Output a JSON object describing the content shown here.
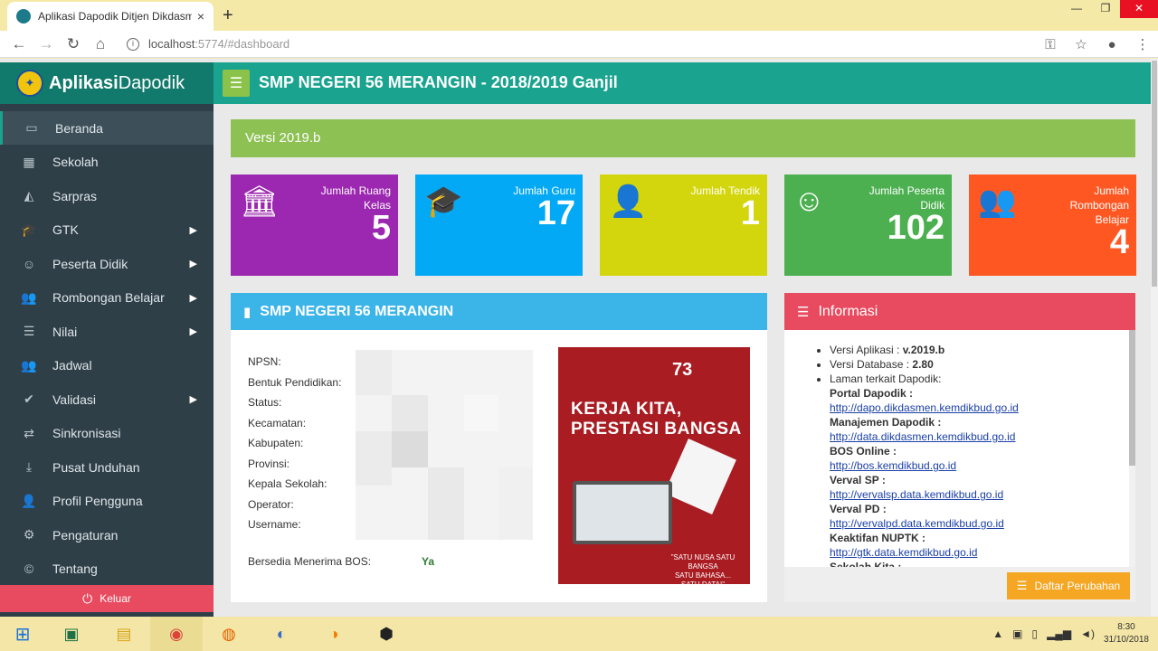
{
  "browser": {
    "tab_title": "Aplikasi Dapodik Ditjen Dikdasm",
    "tab_close": "×",
    "new_tab": "+",
    "url_host": "localhost",
    "url_path": ":5774/#dashboard",
    "min": "—",
    "max": "❐",
    "close": "✕"
  },
  "brand": {
    "bold": "Aplikasi",
    "rest": "Dapodik"
  },
  "header": {
    "title": "SMP NEGERI 56 MERANGIN - 2018/2019 Ganjil"
  },
  "sidebar": {
    "items": [
      {
        "label": "Beranda",
        "icon": "monitor-icon",
        "glyph": "▭",
        "arrow": false
      },
      {
        "label": "Sekolah",
        "icon": "building-icon",
        "glyph": "▦",
        "arrow": false
      },
      {
        "label": "Sarpras",
        "icon": "road-icon",
        "glyph": "◭",
        "arrow": false
      },
      {
        "label": "GTK",
        "icon": "graduation-cap-icon",
        "glyph": "🎓",
        "arrow": true
      },
      {
        "label": "Peserta Didik",
        "icon": "smile-icon",
        "glyph": "☺",
        "arrow": true
      },
      {
        "label": "Rombongan Belajar",
        "icon": "users-icon",
        "glyph": "👥",
        "arrow": true
      },
      {
        "label": "Nilai",
        "icon": "list-icon",
        "glyph": "☰",
        "arrow": true
      },
      {
        "label": "Jadwal",
        "icon": "group-icon",
        "glyph": "👥",
        "arrow": false
      },
      {
        "label": "Validasi",
        "icon": "check-icon",
        "glyph": "✔",
        "arrow": true
      },
      {
        "label": "Sinkronisasi",
        "icon": "exchange-icon",
        "glyph": "⇄",
        "arrow": false
      },
      {
        "label": "Pusat Unduhan",
        "icon": "download-icon",
        "glyph": "⤓",
        "arrow": false
      },
      {
        "label": "Profil Pengguna",
        "icon": "user-icon",
        "glyph": "👤",
        "arrow": false
      },
      {
        "label": "Pengaturan",
        "icon": "gear-icon",
        "glyph": "⚙",
        "arrow": false
      },
      {
        "label": "Tentang",
        "icon": "copyright-icon",
        "glyph": "©",
        "arrow": false
      }
    ],
    "logout": "Keluar"
  },
  "versi": "Versi 2019.b",
  "tiles": [
    {
      "label": "Jumlah Ruang Kelas",
      "value": "5",
      "color": "#9c27b0",
      "icon": "institution-icon",
      "glyph": "🏛"
    },
    {
      "label": "Jumlah Guru",
      "value": "17",
      "color": "#03a9f4",
      "icon": "graduation-cap-icon",
      "glyph": "🎓"
    },
    {
      "label": "Jumlah Tendik",
      "value": "1",
      "color": "#d4d60d",
      "icon": "user-icon",
      "glyph": "👤"
    },
    {
      "label": "Jumlah Peserta Didik",
      "value": "102",
      "color": "#4caf50",
      "icon": "smile-icon",
      "glyph": "☺"
    },
    {
      "label": "Jumlah Rombongan Belajar",
      "value": "4",
      "color": "#ff5722",
      "icon": "users-icon",
      "glyph": "👥"
    }
  ],
  "school_panel": {
    "title": "SMP NEGERI 56 MERANGIN",
    "fields": [
      "NPSN:",
      "Bentuk Pendidikan:",
      "Status:",
      "Kecamatan:",
      "Kabupaten:",
      "Provinsi:",
      "Kepala Sekolah:",
      "Operator:",
      "Username:"
    ],
    "bos_label": "Bersedia Menerima BOS:",
    "bos_value": "Ya",
    "poster": {
      "number": "73",
      "line1": "KERJA KITA,",
      "line2": "PRESTASI BANGSA",
      "tag1": "\"SATU NUSA SATU BANGSA",
      "tag2": "SATU BAHASA...",
      "tag3": "SATU DATA!\""
    }
  },
  "info_panel": {
    "title": "Informasi",
    "versi_aplikasi_label": "Versi Aplikasi : ",
    "versi_aplikasi": "v.2019.b",
    "versi_db_label": "Versi Database : ",
    "versi_db": "2.80",
    "laman": "Laman terkait Dapodik:",
    "links": [
      {
        "name": "Portal Dapodik :",
        "url": "http://dapo.dikdasmen.kemdikbud.go.id"
      },
      {
        "name": "Manajemen Dapodik :",
        "url": "http://data.dikdasmen.kemdikbud.go.id"
      },
      {
        "name": "BOS Online :",
        "url": "http://bos.kemdikbud.go.id"
      },
      {
        "name": "Verval SP :",
        "url": "http://vervalsp.data.kemdikbud.go.id"
      },
      {
        "name": "Verval PD :",
        "url": "http://vervalpd.data.kemdikbud.go.id"
      },
      {
        "name": "Keaktifan NUPTK :",
        "url": "http://gtk.data.kemdikbud.go.id"
      },
      {
        "name": "Sekolah Kita :",
        "url": ""
      }
    ],
    "daftar": "Daftar Perubahan"
  },
  "taskbar": {
    "time": "8:30",
    "date": "31/10/2018"
  }
}
